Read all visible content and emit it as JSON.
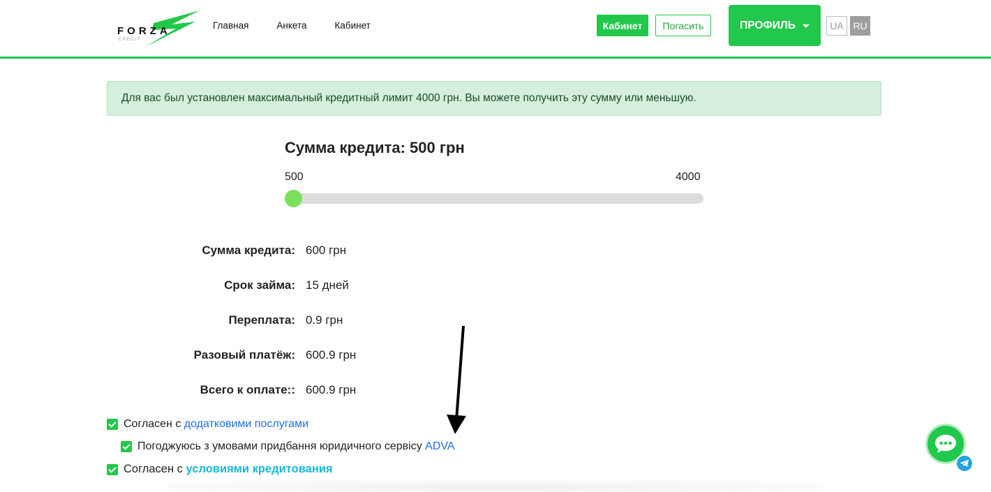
{
  "header": {
    "logo_text": "FORZA",
    "logo_sub": "CREDIT",
    "nav": [
      "Главная",
      "Анкета",
      "Кабинет"
    ],
    "cabinet_button": "Кабинет",
    "repay_button": "Погасить",
    "profile_button": "ПРОФИЛЬ",
    "lang_ua": "UA",
    "lang_ru": "RU"
  },
  "alert": {
    "text": "Для вас был установлен максимальный кредитный лимит 4000 грн. Вы можете получить эту сумму или меньшую."
  },
  "slider": {
    "title": "Сумма кредита: 500 грн",
    "min_label": "500",
    "max_label": "4000",
    "value": 500,
    "min": 500,
    "max": 4000
  },
  "details": [
    {
      "label": "Сумма кредита:",
      "value": "600 грн"
    },
    {
      "label": "Срок займа:",
      "value": "15 дней"
    },
    {
      "label": "Переплата:",
      "value": "0.9 грн"
    },
    {
      "label": "Разовый платёж:",
      "value": "600.9 грн"
    },
    {
      "label": "Всего к оплате::",
      "value": "600.9 грн"
    }
  ],
  "agreements": {
    "first_prefix": "Согласен с ",
    "first_link": "додатковими послугами",
    "second_prefix": "Погоджуюсь з умовами придбання юридичного сервісу ",
    "second_link": "ADVA",
    "third_prefix": "Согласен с ",
    "third_link": "условиями кредитования"
  },
  "colors": {
    "brand_green": "#22c84b",
    "alert_bg": "#d4f0dc",
    "link_blue": "#1f6fe0",
    "link_cyan": "#19b8d6",
    "telegram": "#27a3de"
  },
  "icons": [
    "logo",
    "caret-down-icon",
    "check-icon",
    "arrow-annotation",
    "chat-icon",
    "telegram-icon"
  ]
}
